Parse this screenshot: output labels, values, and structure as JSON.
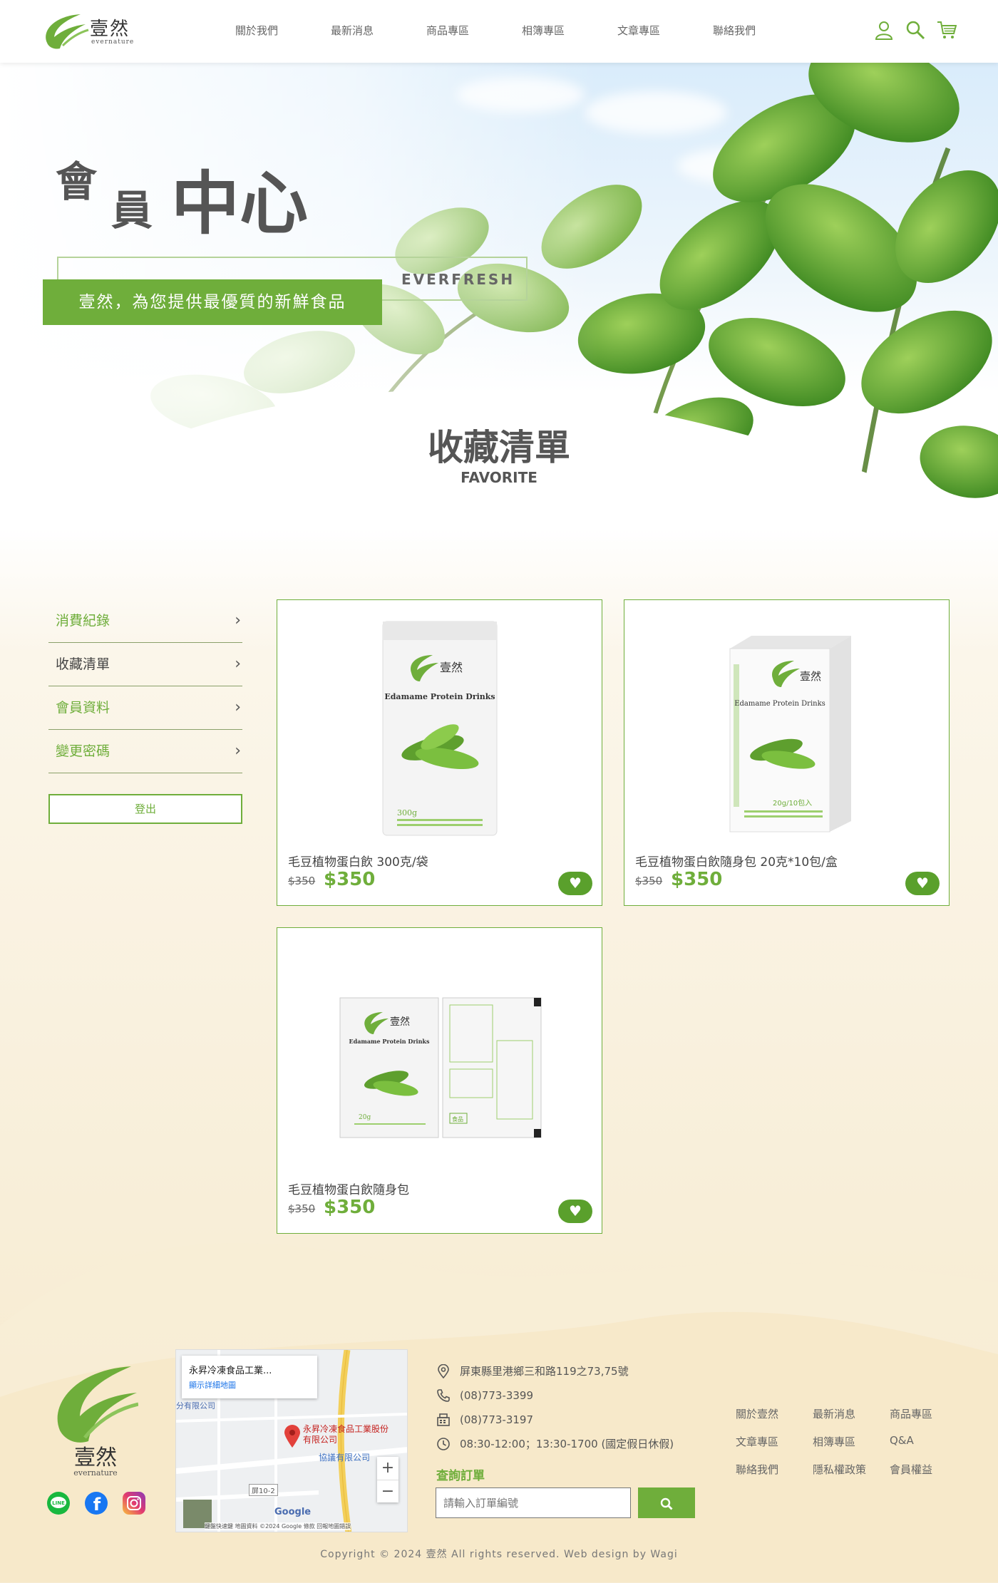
{
  "header": {
    "logo_zh": "壹然",
    "logo_en": "evernature",
    "nav": [
      "關於我們",
      "最新消息",
      "商品專區",
      "相簿專區",
      "文章專區",
      "聯絡我們"
    ],
    "icons": [
      "user-icon",
      "search-icon",
      "cart-icon"
    ]
  },
  "hero": {
    "title_c1": "會",
    "title_c2": "員",
    "title_c3": "中心",
    "everfresh": "EVERFRESH",
    "slogan": "壹然，為您提供最優質的新鮮食品"
  },
  "section": {
    "title": "收藏清單",
    "subtitle": "FAVORITE"
  },
  "sidebar": {
    "items": [
      {
        "label": "消費紀錄",
        "active": false
      },
      {
        "label": "收藏清單",
        "active": true
      },
      {
        "label": "會員資料",
        "active": false
      },
      {
        "label": "變更密碼",
        "active": false
      }
    ],
    "logout": "登出"
  },
  "products": [
    {
      "name": "毛豆植物蛋白飲 300克/袋",
      "orig_price": "$350",
      "price": "$350"
    },
    {
      "name": "毛豆植物蛋白飲隨身包 20克*10包/盒",
      "orig_price": "$350",
      "price": "$350"
    },
    {
      "name": "毛豆植物蛋白飲隨身包",
      "orig_price": "$350",
      "price": "$350"
    }
  ],
  "product_art": {
    "brand": "壹然",
    "brand_en": "evernature",
    "product_line": "Edamame Protein Drinks",
    "bag_weight": "300g",
    "box_weight": "20g/10包入",
    "sachet_weight": "20g",
    "sachet_label": "食品"
  },
  "footer": {
    "logo_zh": "壹然",
    "logo_en": "evernature",
    "social": [
      "line-icon",
      "facebook-icon",
      "instagram-icon"
    ],
    "map": {
      "place": "永昇冷凍食品工業...",
      "detail_link": "顯示詳細地圖",
      "marker_label": "永昇冷凍食品工業股份有限公司",
      "nearby": "協議有限公司",
      "partial_label": "分有限公司",
      "road": "屏10-2",
      "google": "Google",
      "attribution": "鍵盤快速鍵  地圖資料 ©2024 Google  條款  回報地圖錯誤"
    },
    "address": "屏東縣里港鄉三和路119之73,75號",
    "phone": "(08)773-3399",
    "fax": "(08)773-3197",
    "hours": "08:30-12:00；13:30-1700 (國定假日休假)",
    "query_label": "查詢訂單",
    "query_placeholder": "請輸入訂單編號",
    "links": [
      "關於壹然",
      "最新消息",
      "商品專區",
      "文章專區",
      "相簿專區",
      "Q&A",
      "聯絡我們",
      "隱私權政策",
      "會員權益"
    ],
    "copyright": "Copyright © 2024 壹然 All rights reserved. Web design by Wagi"
  },
  "colors": {
    "accent": "#6fae3b",
    "dark_green": "#5aa02c",
    "cream": "#f7ecd3"
  }
}
